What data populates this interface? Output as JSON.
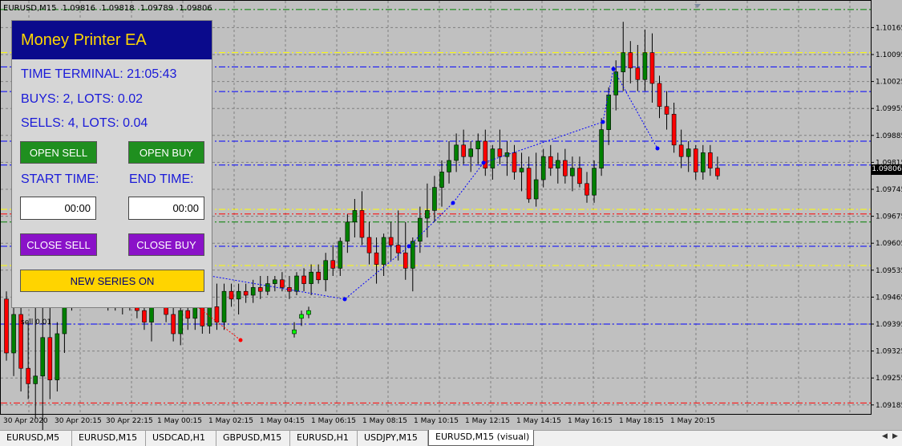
{
  "symbol_header": {
    "symbol": "EURUSD,M15",
    "open": "1.09816",
    "high": "1.09818",
    "low": "1.09789",
    "close": "1.09806"
  },
  "ea_panel": {
    "title": "Money Printer EA",
    "time_terminal": "TIME TERMINAL: 21:05:43",
    "buys": "BUYS: 2, LOTS: 0.02",
    "sells": "SELLS: 4, LOTS: 0.04",
    "open_sell": "OPEN SELL",
    "open_buy": "OPEN BUY",
    "start_time_label": "START TIME:",
    "end_time_label": "END TIME:",
    "start_time_value": "00:00",
    "end_time_value": "00:00",
    "close_sell": "CLOSE SELL",
    "close_buy": "CLOSE BUY",
    "new_series": "NEW SERIES ON"
  },
  "order_label": "sell 0.01",
  "current_price": "1.09806",
  "price_axis": {
    "min": 1.0917,
    "max": 1.1022,
    "ticks": [
      "1.10165",
      "1.10095",
      "1.10025",
      "1.09955",
      "1.09885",
      "1.09815",
      "1.09745",
      "1.09675",
      "1.09605",
      "1.09535",
      "1.09465",
      "1.09395",
      "1.09325",
      "1.09255",
      "1.09185"
    ]
  },
  "time_axis": {
    "labels": [
      "30 Apr 2020",
      "30 Apr 20:15",
      "30 Apr 22:15",
      "1 May 00:15",
      "1 May 02:15",
      "1 May 04:15",
      "1 May 06:15",
      "1 May 08:15",
      "1 May 10:15",
      "1 May 12:15",
      "1 May 14:15",
      "1 May 16:15",
      "1 May 18:15",
      "1 May 20:15"
    ]
  },
  "colors": {
    "background": "#c0c0c0",
    "bull": "#008000",
    "bear": "#ff0000",
    "grid": "#808080",
    "panel_title_bg": "#0a0a8c",
    "panel_title_text": "#ffd700",
    "panel_text": "#1a1ad8",
    "btn_green": "#1f8f1f",
    "btn_purple": "#8a12c8",
    "btn_yellow": "#ffd400"
  },
  "level_lines": [
    {
      "price": 1.10212,
      "color": "#008000"
    },
    {
      "price": 1.101,
      "color": "#ffff00"
    },
    {
      "price": 1.10063,
      "color": "#0000ff"
    },
    {
      "price": 1.09999,
      "color": "#0000ff"
    },
    {
      "price": 1.0987,
      "color": "#0000ff"
    },
    {
      "price": 1.09808,
      "color": "#0000ff"
    },
    {
      "price": 1.09693,
      "color": "#ffff00"
    },
    {
      "price": 1.09681,
      "color": "#ff0000"
    },
    {
      "price": 1.0966,
      "color": "#008000"
    },
    {
      "price": 1.09597,
      "color": "#0000ff"
    },
    {
      "price": 1.09547,
      "color": "#ffff00"
    },
    {
      "price": 1.09395,
      "color": "#0000ff"
    },
    {
      "price": 1.0919,
      "color": "#ff0000"
    }
  ],
  "chart_data": {
    "type": "candlestick",
    "bar_spacing": 5.3,
    "candles": [
      [
        1.0946,
        1.0948,
        1.093,
        1.0932
      ],
      [
        1.0932,
        1.0948,
        1.0926,
        1.0942
      ],
      [
        1.0942,
        1.0948,
        1.0922,
        1.0928
      ],
      [
        1.0928,
        1.094,
        1.092,
        1.0924
      ],
      [
        1.0924,
        1.0945,
        1.0915,
        1.0926
      ],
      [
        1.0926,
        1.0944,
        1.0912,
        1.0936
      ],
      [
        1.0936,
        1.095,
        1.092,
        1.0925
      ],
      [
        1.0925,
        1.094,
        1.0922,
        1.0937
      ],
      [
        1.0937,
        1.0955,
        1.0932,
        1.095
      ],
      [
        1.095,
        1.0958,
        1.0943,
        1.0956
      ],
      [
        1.0956,
        1.0962,
        1.095,
        1.096
      ],
      [
        1.096,
        1.0965,
        1.0952,
        1.0962
      ],
      [
        1.0952,
        1.0957,
        1.0948,
        1.095
      ],
      [
        1.095,
        1.0955,
        1.0944,
        1.0946
      ],
      [
        1.0946,
        1.0951,
        1.0943,
        1.0945
      ],
      [
        1.0945,
        1.0951,
        1.0943,
        1.0949
      ],
      [
        1.0949,
        1.0951,
        1.0942,
        1.0944
      ],
      [
        1.0944,
        1.0948,
        1.0943,
        1.0947
      ],
      [
        1.0947,
        1.095,
        1.0941,
        1.0943
      ],
      [
        1.0943,
        1.0948,
        1.0938,
        1.094
      ],
      [
        1.094,
        1.0948,
        1.0935,
        1.0947
      ],
      [
        1.0947,
        1.0958,
        1.0945,
        1.0945
      ],
      [
        1.0945,
        1.095,
        1.094,
        1.0942
      ],
      [
        1.0942,
        1.0948,
        1.0935,
        1.0937
      ],
      [
        1.0937,
        1.0945,
        1.0934,
        1.0943
      ],
      [
        1.0943,
        1.0946,
        1.0938,
        1.0941
      ],
      [
        1.0941,
        1.0947,
        1.0938,
        1.0945
      ],
      [
        1.0945,
        1.0948,
        1.0937,
        1.0939
      ],
      [
        1.0939,
        1.0946,
        1.0937,
        1.0944
      ],
      [
        1.0944,
        1.095,
        1.0938,
        1.094
      ],
      [
        1.094,
        1.095,
        1.0938,
        1.0948
      ],
      [
        1.0948,
        1.095,
        1.0944,
        1.0946
      ],
      [
        1.0946,
        1.095,
        1.0942,
        1.0948
      ],
      [
        1.0948,
        1.095,
        1.0945,
        1.0947
      ],
      [
        1.0947,
        1.0951,
        1.0945,
        1.0949
      ],
      [
        1.0949,
        1.0952,
        1.0946,
        1.0948
      ],
      [
        1.0948,
        1.0952,
        1.0947,
        1.095
      ],
      [
        1.095,
        1.0952,
        1.0948,
        1.0951
      ],
      [
        1.0951,
        1.0953,
        1.0948,
        1.0949
      ],
      [
        1.0949,
        1.0952,
        1.0946,
        1.0948
      ],
      [
        1.0948,
        1.0953,
        1.0947,
        1.0952
      ],
      [
        1.0952,
        1.0954,
        1.0948,
        1.095
      ],
      [
        1.095,
        1.0955,
        1.0947,
        1.0953
      ],
      [
        1.0953,
        1.0955,
        1.095,
        1.0951
      ],
      [
        1.0951,
        1.0958,
        1.0948,
        1.0956
      ],
      [
        1.0956,
        1.096,
        1.0952,
        1.0954
      ],
      [
        1.0954,
        1.0962,
        1.0952,
        1.0961
      ],
      [
        1.0961,
        1.0968,
        1.0958,
        1.0966
      ],
      [
        1.0966,
        1.0972,
        1.0962,
        1.0969
      ],
      [
        1.0969,
        1.0974,
        1.096,
        1.0962
      ],
      [
        1.0962,
        1.0966,
        1.0955,
        1.0958
      ],
      [
        1.0958,
        1.0962,
        1.095,
        1.0955
      ],
      [
        1.0955,
        1.0963,
        1.0952,
        1.0962
      ],
      [
        1.0962,
        1.0966,
        1.0956,
        1.096
      ],
      [
        1.096,
        1.0969,
        1.0956,
        1.0958
      ],
      [
        1.0958,
        1.0966,
        1.0951,
        1.0954
      ],
      [
        1.0954,
        1.0962,
        1.0948,
        1.0961
      ],
      [
        1.0961,
        1.097,
        1.0958,
        1.0967
      ],
      [
        1.0967,
        1.0976,
        1.0962,
        1.0969
      ],
      [
        1.0969,
        1.0978,
        1.0966,
        1.0975
      ],
      [
        1.0975,
        1.0982,
        1.097,
        1.0979
      ],
      [
        1.0979,
        1.0987,
        1.0976,
        1.0982
      ],
      [
        1.0982,
        1.0989,
        1.0979,
        1.0986
      ],
      [
        1.0986,
        1.099,
        1.0981,
        1.0983
      ],
      [
        1.0983,
        1.0987,
        1.0979,
        1.0985
      ],
      [
        1.0985,
        1.0989,
        1.0981,
        1.0987
      ],
      [
        1.0987,
        1.099,
        1.0978,
        1.098
      ],
      [
        1.098,
        1.0986,
        1.0977,
        1.0985
      ],
      [
        1.0985,
        1.099,
        1.0981,
        1.0983
      ],
      [
        1.0983,
        1.0987,
        1.0978,
        1.0984
      ],
      [
        1.0984,
        1.0986,
        1.0977,
        1.0979
      ],
      [
        1.0979,
        1.0984,
        1.0974,
        1.098
      ],
      [
        1.098,
        1.0983,
        1.0971,
        1.0972
      ],
      [
        1.0972,
        1.0984,
        1.097,
        1.0977
      ],
      [
        1.0977,
        1.0985,
        1.0975,
        1.0983
      ],
      [
        1.0983,
        1.0986,
        1.0978,
        1.098
      ],
      [
        1.098,
        1.0984,
        1.0976,
        1.0982
      ],
      [
        1.0982,
        1.0985,
        1.0976,
        1.0978
      ],
      [
        1.0978,
        1.0983,
        1.0974,
        1.098
      ],
      [
        1.098,
        1.0983,
        1.0975,
        1.0976
      ],
      [
        1.0976,
        1.0979,
        1.0971,
        1.0973
      ],
      [
        1.0973,
        1.0982,
        1.0971,
        1.098
      ],
      [
        1.098,
        1.0993,
        1.0978,
        1.099
      ],
      [
        1.099,
        1.1001,
        1.0986,
        1.0999
      ],
      [
        1.0999,
        1.1008,
        1.0995,
        1.1005
      ],
      [
        1.1005,
        1.1018,
        1.1,
        1.101
      ],
      [
        1.101,
        1.1013,
        1.1002,
        1.1006
      ],
      [
        1.1006,
        1.1012,
        1.1,
        1.1003
      ],
      [
        1.1003,
        1.1016,
        1.1,
        1.101
      ],
      [
        1.101,
        1.1015,
        1.0997,
        1.1002
      ],
      [
        1.1002,
        1.1004,
        1.0993,
        1.0996
      ],
      [
        1.0996,
        1.1,
        1.099,
        1.0994
      ],
      [
        1.0994,
        1.0997,
        1.0984,
        1.0986
      ],
      [
        1.0986,
        1.099,
        1.098,
        1.0983
      ],
      [
        1.0983,
        1.0987,
        1.0979,
        1.0985
      ],
      [
        1.0985,
        1.0986,
        1.0977,
        1.0979
      ],
      [
        1.0979,
        1.0986,
        1.0977,
        1.0984
      ],
      [
        1.0984,
        1.0986,
        1.0978,
        1.098
      ],
      [
        1.098,
        1.0983,
        1.0977,
        1.0978
      ]
    ],
    "special_candles": [
      [
        1.0937,
        1.094,
        1.0936,
        1.0938,
        "#00ff00"
      ],
      [
        1.0941,
        1.0943,
        1.0939,
        1.0942,
        "#00ff00"
      ],
      [
        1.0943,
        1.0944,
        1.0941,
        1.0942,
        "#00ff00"
      ]
    ]
  },
  "trade_markers": {
    "sell_path": [
      [
        187,
        331
      ],
      [
        430,
        373
      ],
      [
        510,
        307
      ],
      [
        565,
        253
      ],
      [
        603,
        203
      ],
      [
        752,
        152
      ],
      [
        765,
        86
      ],
      [
        820,
        185
      ]
    ],
    "buy_path": [
      [
        194,
        342
      ],
      [
        300,
        424
      ]
    ]
  }
}
